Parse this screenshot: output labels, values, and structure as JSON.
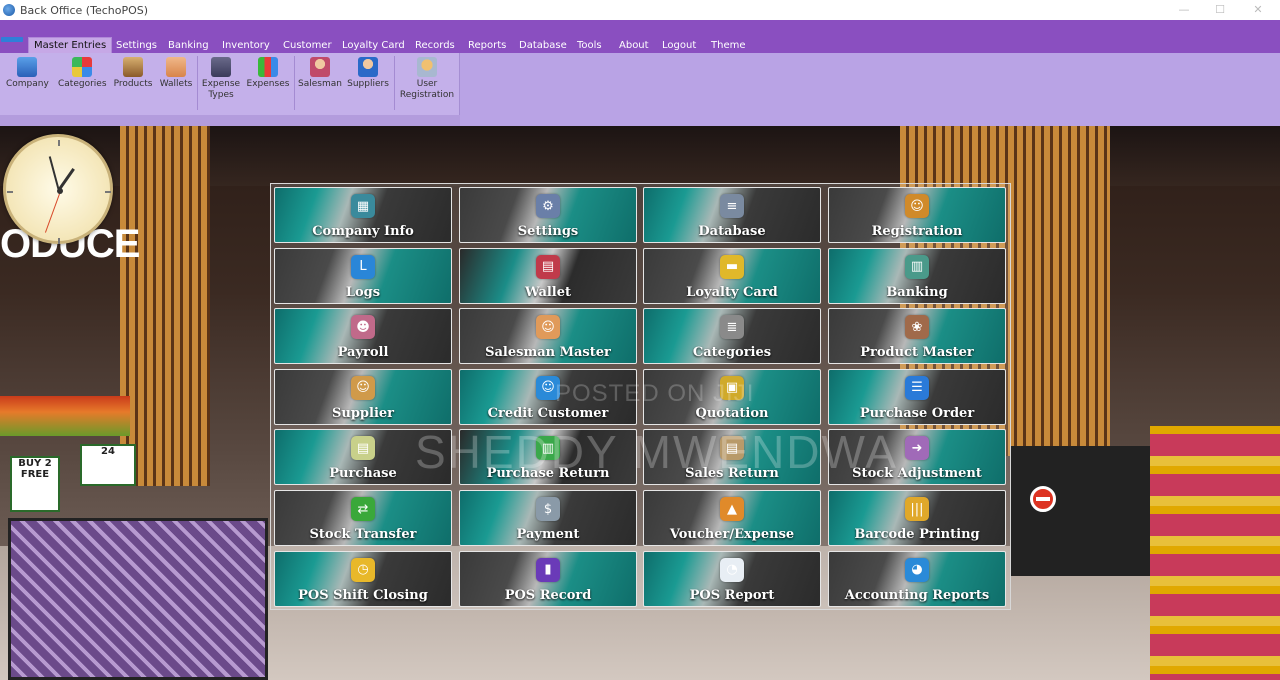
{
  "window": {
    "title": "Back Office (TechoPOS)"
  },
  "menu": {
    "items": [
      "Master Entries",
      "Settings",
      "Banking",
      "Inventory",
      "Customer",
      "Loyalty Card",
      "Records",
      "Reports",
      "Database",
      "Tools",
      "About",
      "Logout",
      "Theme"
    ],
    "active": "Master Entries"
  },
  "ribbon": {
    "buttons": [
      {
        "label": "Company",
        "icon": "company-icon"
      },
      {
        "label": "Categories",
        "icon": "categories-icon"
      },
      {
        "label": "Products",
        "icon": "products-icon"
      },
      {
        "label": "Wallets",
        "icon": "wallets-icon"
      },
      {
        "label": "Expense Types",
        "icon": "expense-types-icon"
      },
      {
        "label": "Expenses",
        "icon": "expenses-icon"
      },
      {
        "label": "Salesman",
        "icon": "salesman-icon"
      },
      {
        "label": "Suppliers",
        "icon": "suppliers-icon"
      },
      {
        "label": "User Registration",
        "icon": "user-registration-icon"
      }
    ]
  },
  "dashboard": {
    "tiles": [
      {
        "label": "Company Info",
        "icon": "company-info-icon",
        "glyph": "▦",
        "color": "#3a8a9c"
      },
      {
        "label": "Settings",
        "icon": "settings-icon",
        "glyph": "⚙",
        "color": "#6a7fa8"
      },
      {
        "label": "Database",
        "icon": "database-icon",
        "glyph": "≡",
        "color": "#7a8aa0"
      },
      {
        "label": "Registration",
        "icon": "registration-icon",
        "glyph": "☺",
        "color": "#d08a2a"
      },
      {
        "label": "Logs",
        "icon": "logs-icon",
        "glyph": "L",
        "color": "#2a86d8"
      },
      {
        "label": "Wallet",
        "icon": "wallet-icon",
        "glyph": "▤",
        "color": "#c03a4a"
      },
      {
        "label": "Loyalty Card",
        "icon": "loyalty-card-icon",
        "glyph": "▬",
        "color": "#e0b82a"
      },
      {
        "label": "Banking",
        "icon": "banking-icon",
        "glyph": "▥",
        "color": "#4a9a8a"
      },
      {
        "label": "Payroll",
        "icon": "payroll-icon",
        "glyph": "☻",
        "color": "#c06a8a"
      },
      {
        "label": "Salesman Master",
        "icon": "salesman-master-icon",
        "glyph": "☺",
        "color": "#e09a5a"
      },
      {
        "label": "Categories",
        "icon": "categories-icon",
        "glyph": "≣",
        "color": "#8a8a8a"
      },
      {
        "label": "Product Master",
        "icon": "product-master-icon",
        "glyph": "❀",
        "color": "#a06a4a"
      },
      {
        "label": "Supplier",
        "icon": "supplier-icon",
        "glyph": "☺",
        "color": "#d09a4a"
      },
      {
        "label": "Credit Customer",
        "icon": "credit-customer-icon",
        "glyph": "☺",
        "color": "#2a8ad8"
      },
      {
        "label": "Quotation",
        "icon": "quotation-icon",
        "glyph": "▣",
        "color": "#d0aa2a"
      },
      {
        "label": "Purchase Order",
        "icon": "purchase-order-icon",
        "glyph": "☰",
        "color": "#2a7ad8"
      },
      {
        "label": "Purchase",
        "icon": "purchase-icon",
        "glyph": "▤",
        "color": "#c8d08a"
      },
      {
        "label": "Purchase Return",
        "icon": "purchase-return-icon",
        "glyph": "▥",
        "color": "#3aa84a"
      },
      {
        "label": "Sales Return",
        "icon": "sales-return-icon",
        "glyph": "▤",
        "color": "#b89a6a"
      },
      {
        "label": "Stock Adjustment",
        "icon": "stock-adjustment-icon",
        "glyph": "➜",
        "color": "#a06ab8"
      },
      {
        "label": "Stock Transfer",
        "icon": "stock-transfer-icon",
        "glyph": "⇄",
        "color": "#3aa83a"
      },
      {
        "label": "Payment",
        "icon": "payment-icon",
        "glyph": "$",
        "color": "#8a9aa8"
      },
      {
        "label": "Voucher/Expense",
        "icon": "voucher-expense-icon",
        "glyph": "▲",
        "color": "#e08a2a"
      },
      {
        "label": "Barcode Printing",
        "icon": "barcode-printing-icon",
        "glyph": "|||",
        "color": "#e0a82a"
      },
      {
        "label": "POS Shift Closing",
        "icon": "pos-shift-closing-icon",
        "glyph": "◷",
        "color": "#e8b82a"
      },
      {
        "label": "POS Record",
        "icon": "pos-record-icon",
        "glyph": "▮",
        "color": "#6a3ab8"
      },
      {
        "label": "POS Report",
        "icon": "pos-report-icon",
        "glyph": "◔",
        "color": "#e8eef4"
      },
      {
        "label": "Accounting Reports",
        "icon": "accounting-reports-icon",
        "glyph": "◕",
        "color": "#2a8ad8"
      }
    ]
  },
  "watermark": {
    "line1": "POSTED ON JIJI",
    "line2": "SHEDDY MWENDWA"
  },
  "scene": {
    "sign": "ODUCE",
    "price1": "BUY 2 FREE",
    "price2": "24"
  }
}
